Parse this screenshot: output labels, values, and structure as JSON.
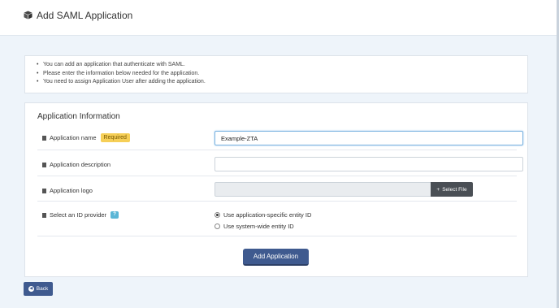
{
  "header": {
    "title": "Add SAML Application",
    "icon": "cube-icon"
  },
  "info": {
    "lines": [
      "You can add an application that authenticate with SAML.",
      "Please enter the information below needed for the application.",
      "You need to assign Application User after adding the application."
    ]
  },
  "form": {
    "section_title": "Application Information",
    "app_name": {
      "label": "Application name",
      "badge": "Required",
      "value": "Example-ZTA"
    },
    "app_description": {
      "label": "Application description",
      "value": ""
    },
    "app_logo": {
      "label": "Application logo",
      "button": "Select File",
      "button_icon": "plus-icon"
    },
    "id_provider": {
      "label": "Select an ID provider",
      "help_badge": "?",
      "options": [
        "Use application-specific entity ID",
        "Use system-wide entity ID"
      ],
      "selected_index": 0
    },
    "submit": "Add Application"
  },
  "back": {
    "label": "Back",
    "icon": "arrow-left-icon"
  },
  "colors": {
    "primary": "#3f5a8f",
    "required_badge": "#f6cf57",
    "help_badge": "#5bb6d6",
    "background": "#eef4fa"
  }
}
